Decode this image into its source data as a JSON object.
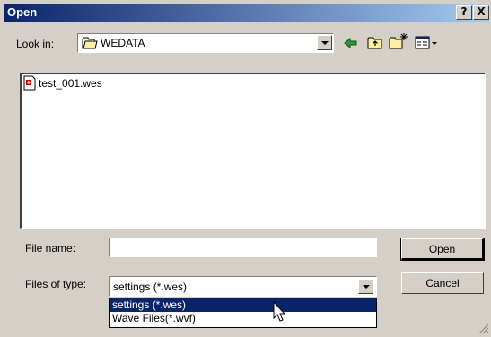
{
  "window": {
    "title": "Open"
  },
  "titlebar_buttons": {
    "help": "?",
    "close": "X"
  },
  "look_in": {
    "label": "Look in:",
    "value": "WEDATA"
  },
  "files": [
    {
      "name": "test_001.wes",
      "icon": "settings-file-icon"
    }
  ],
  "file_name": {
    "label": "File name:",
    "value": ""
  },
  "files_of_type": {
    "label": "Files of type:",
    "value": "settings (*.wes)",
    "options": [
      "settings (*.wes)",
      "Wave Files(*.wvf)"
    ]
  },
  "buttons": {
    "open": "Open",
    "cancel": "Cancel"
  },
  "colors": {
    "title_start": "#0a246a",
    "title_end": "#a6caf0",
    "selection": "#0a246a",
    "face": "#d4d0c8"
  }
}
